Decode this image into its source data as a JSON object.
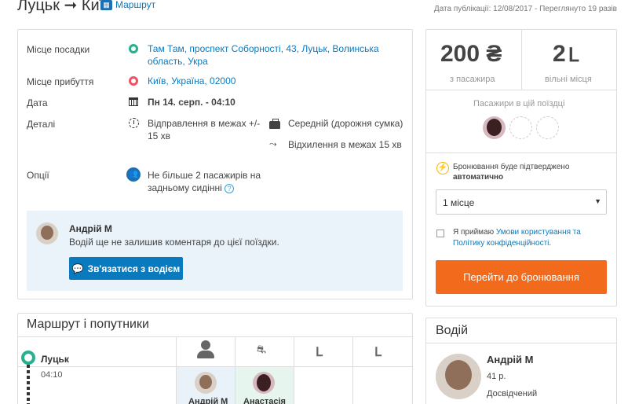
{
  "header": {
    "route": "Луцьк ➞ Київ",
    "map_link": "Маршрут",
    "publication": "Дата публікації: 12/08/2017 - Переглянуто 19 разів"
  },
  "details": {
    "pickup_label": "Місце посадки",
    "pickup_value": "Там Там, проспект Соборності, 43, Луцьк, Волинська область, Укра",
    "arrival_label": "Місце прибуття",
    "arrival_value": "Київ, Україна, 02000",
    "date_label": "Дата",
    "date_value": "Пн 14. серп. - 04:10",
    "details_label": "Деталі",
    "departure_window": "Відправлення в межах +/- 15 хв",
    "luggage": "Середній (дорожня сумка)",
    "detour": "Відхилення в межах 15 хв",
    "options_label": "Опції",
    "options_value": "Не більше 2 пасажирів на задньому сидінні"
  },
  "comment": {
    "author": "Андрій М",
    "text": "Водій ще не залишив коментаря до цієї поїздки.",
    "contact_button": "Зв'язатися з водієм"
  },
  "route": {
    "title": "Маршрут і попутники",
    "stop": "Луцьк",
    "time": "04:10",
    "passenger1": "Андрій М",
    "passenger2": "Анастасія"
  },
  "booking": {
    "price": "200 ₴",
    "price_label": "з пасажира",
    "seats": "2",
    "seats_label": "вільні місця",
    "passengers_title": "Пасажири в цій поїздці",
    "auto_confirm_prefix": "Бронювання буде підтверджено",
    "auto_confirm_bold": "автоматично",
    "seat_select": "1 місце",
    "terms_prefix": "Я приймаю",
    "terms_link": "Умови користування та Політику конфіденційності",
    "book_button": "Перейти до бронювання"
  },
  "driver": {
    "title": "Водій",
    "name": "Андрій М",
    "age": "41 р.",
    "experience": "Досвідчений"
  }
}
